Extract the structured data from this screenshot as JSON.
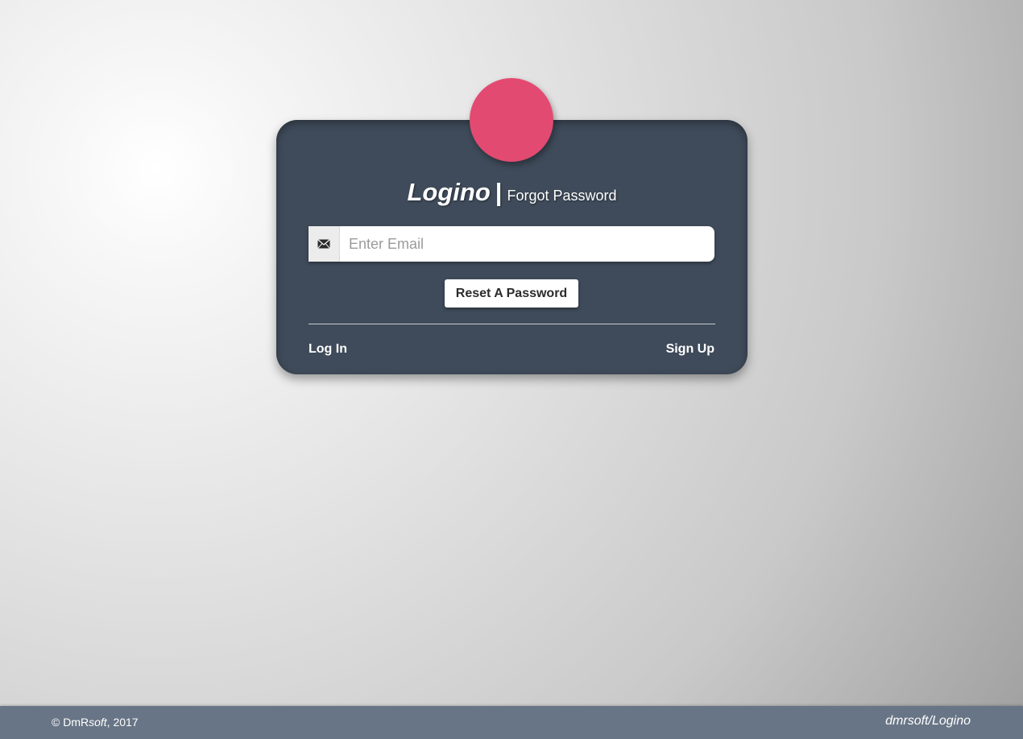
{
  "login_card": {
    "brand": "Logino",
    "separator": "|",
    "subtitle": "Forgot Password",
    "email_icon": "envelope-icon",
    "email_placeholder": "Enter Email",
    "email_value": "",
    "reset_button_label": "Reset A Password",
    "login_link": "Log In",
    "signup_link": "Sign Up"
  },
  "footer": {
    "copyright_prefix": "© DmR",
    "copyright_italic": "soft",
    "copyright_suffix": ", 2017",
    "repo_link": "dmrsoft/Logino"
  },
  "colors": {
    "card_background": "#3f4b5a",
    "avatar": "#e34a71",
    "footer_background": "#687586"
  }
}
